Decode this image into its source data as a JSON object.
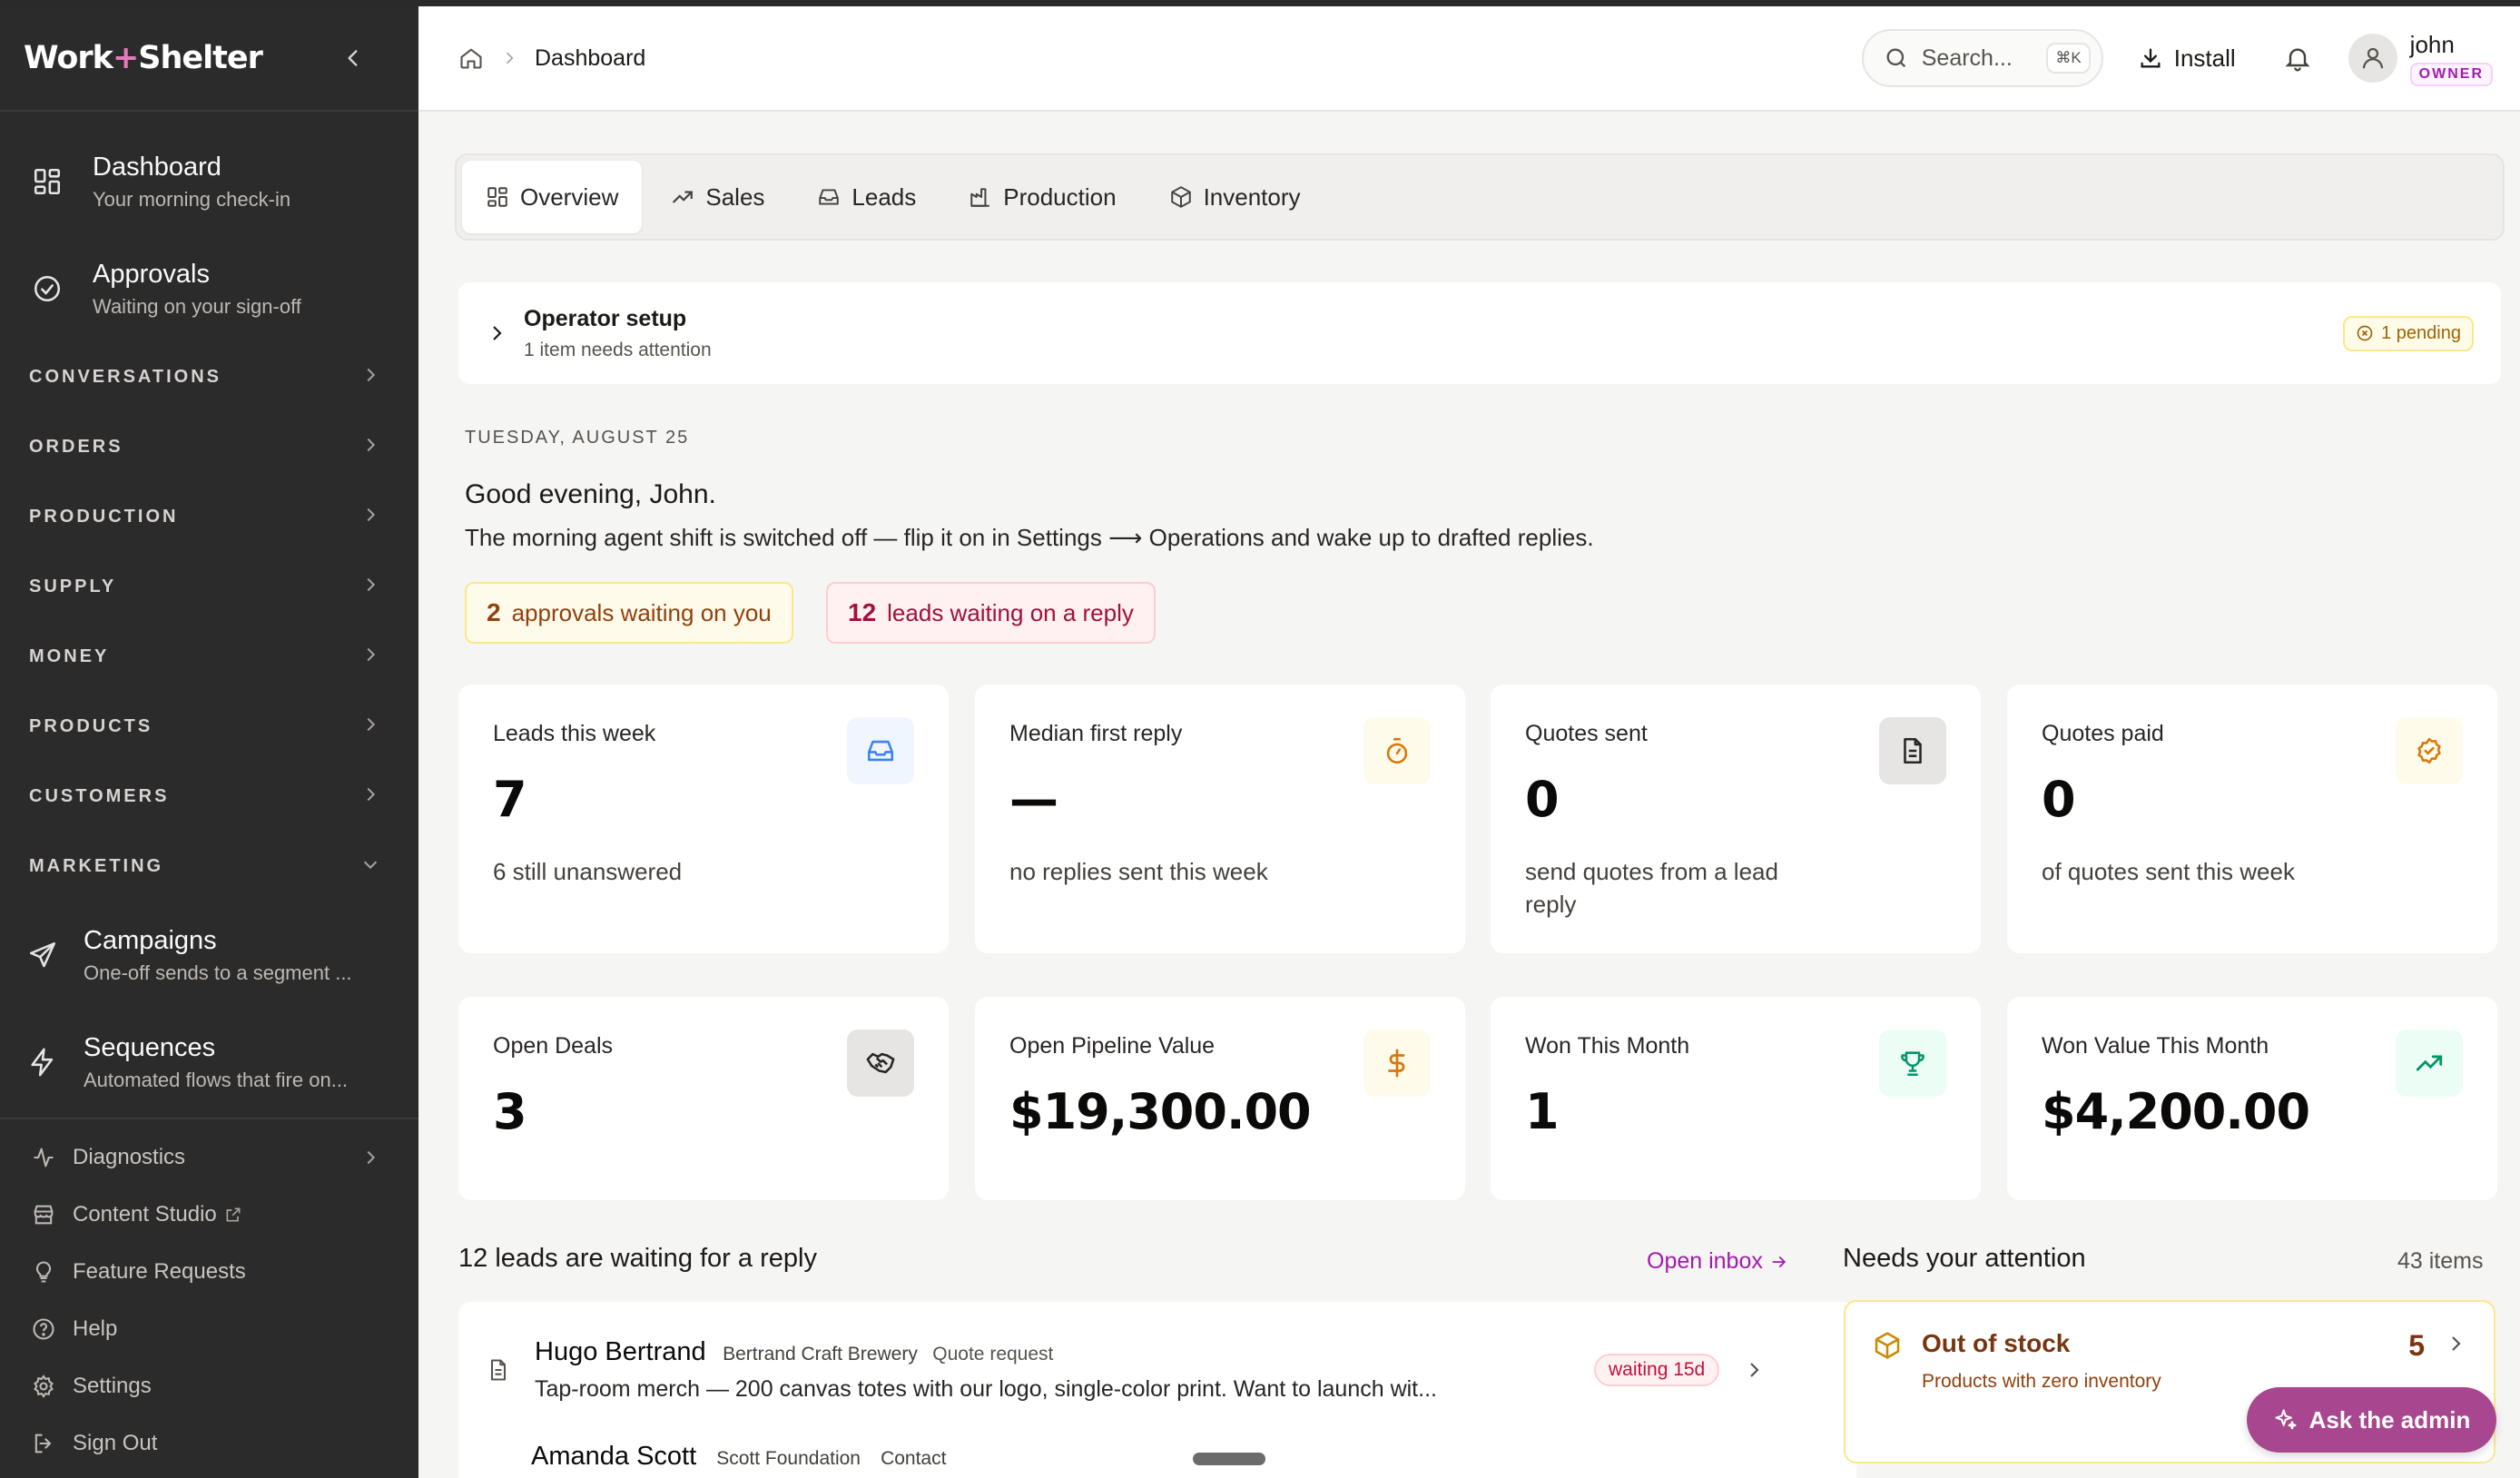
{
  "brand": {
    "part1": "Work",
    "plus": "+",
    "part2": "Shelter"
  },
  "sidebar": {
    "primary": [
      {
        "label": "Dashboard",
        "sub": "Your morning check-in",
        "icon": "dashboard-grid-icon"
      },
      {
        "label": "Approvals",
        "sub": "Waiting on your sign-off",
        "icon": "check-circle-icon"
      }
    ],
    "sections": [
      {
        "label": "CONVERSATIONS",
        "state": "collapsed"
      },
      {
        "label": "ORDERS",
        "state": "collapsed"
      },
      {
        "label": "PRODUCTION",
        "state": "collapsed"
      },
      {
        "label": "SUPPLY",
        "state": "collapsed"
      },
      {
        "label": "MONEY",
        "state": "collapsed"
      },
      {
        "label": "PRODUCTS",
        "state": "collapsed"
      },
      {
        "label": "CUSTOMERS",
        "state": "collapsed"
      },
      {
        "label": "MARKETING",
        "state": "expanded"
      }
    ],
    "marketing_items": [
      {
        "label": "Campaigns",
        "sub": "One-off sends to a segment ...",
        "icon": "send-icon"
      },
      {
        "label": "Sequences",
        "sub": "Automated flows that fire on...",
        "icon": "lightning-icon"
      }
    ],
    "footer": [
      {
        "label": "Diagnostics",
        "icon": "activity-icon"
      },
      {
        "label": "Content Studio",
        "icon": "store-icon"
      },
      {
        "label": "Feature Requests",
        "icon": "lightbulb-icon"
      },
      {
        "label": "Help",
        "icon": "help-icon"
      },
      {
        "label": "Settings",
        "icon": "gear-icon"
      },
      {
        "label": "Sign Out",
        "icon": "sign-out-icon"
      }
    ]
  },
  "header": {
    "breadcrumb": "Dashboard",
    "search_placeholder": "Search...",
    "search_shortcut": "⌘K",
    "install_label": "Install",
    "user_name": "john",
    "user_role": "OWNER"
  },
  "tabs": [
    {
      "label": "Overview",
      "active": true
    },
    {
      "label": "Sales"
    },
    {
      "label": "Leads"
    },
    {
      "label": "Production"
    },
    {
      "label": "Inventory"
    }
  ],
  "setup": {
    "title": "Operator setup",
    "subtitle": "1 item needs attention",
    "pending": "1 pending"
  },
  "date": "TUESDAY, AUGUST 25",
  "greeting": "Good evening, John.",
  "note": "The morning agent shift is switched off — flip it on in Settings ⟶ Operations and wake up to drafted replies.",
  "chips": {
    "approvals_count": "2",
    "approvals_text": "approvals waiting on you",
    "leads_count": "12",
    "leads_text": "leads waiting on a reply"
  },
  "stats_row1": [
    {
      "label": "Leads this week",
      "value": "7",
      "sub": "6 still unanswered",
      "icon": "inbox-icon",
      "tint": "#eff6ff",
      "color": "#3b82f6"
    },
    {
      "label": "Median first reply",
      "value": "—",
      "sub": "no replies sent this week",
      "icon": "stopwatch-icon",
      "tint": "#fffbeb",
      "color": "#d97706"
    },
    {
      "label": "Quotes sent",
      "value": "0",
      "sub": "send quotes from a lead reply",
      "icon": "document-icon",
      "tint": "#e7e5e4",
      "color": "#292524"
    },
    {
      "label": "Quotes paid",
      "value": "0",
      "sub": "of quotes sent this week",
      "icon": "badge-check-icon",
      "tint": "#fffbeb",
      "color": "#d97706"
    }
  ],
  "stats_row2": [
    {
      "label": "Open Deals",
      "value": "3",
      "icon": "handshake-icon",
      "tint": "#e7e5e4",
      "color": "#292524"
    },
    {
      "label": "Open Pipeline Value",
      "value": "$19,300.00",
      "icon": "dollar-icon",
      "tint": "#fffbeb",
      "color": "#d97706"
    },
    {
      "label": "Won This Month",
      "value": "1",
      "icon": "trophy-icon",
      "tint": "#ecfdf5",
      "color": "#059669"
    },
    {
      "label": "Won Value This Month",
      "value": "$4,200.00",
      "icon": "trending-up-icon",
      "tint": "#ecfdf5",
      "color": "#059669"
    }
  ],
  "leads_section": {
    "title": "12 leads are waiting for a reply",
    "link": "Open inbox",
    "items": [
      {
        "name": "Hugo Bertrand",
        "company": "Bertrand Craft Brewery",
        "type": "Quote request",
        "message": "Tap-room merch — 200 canvas totes with our logo, single-color print. Want to launch wit...",
        "waiting": "waiting 15d"
      },
      {
        "name": "Amanda Scott",
        "company": "Scott Foundation",
        "type": "Contact"
      }
    ]
  },
  "attention": {
    "title": "Needs your attention",
    "count": "43 items",
    "items": [
      {
        "title": "Out of stock",
        "sub": "Products with zero inventory",
        "value": "5"
      }
    ]
  },
  "ask_admin": "Ask the admin"
}
